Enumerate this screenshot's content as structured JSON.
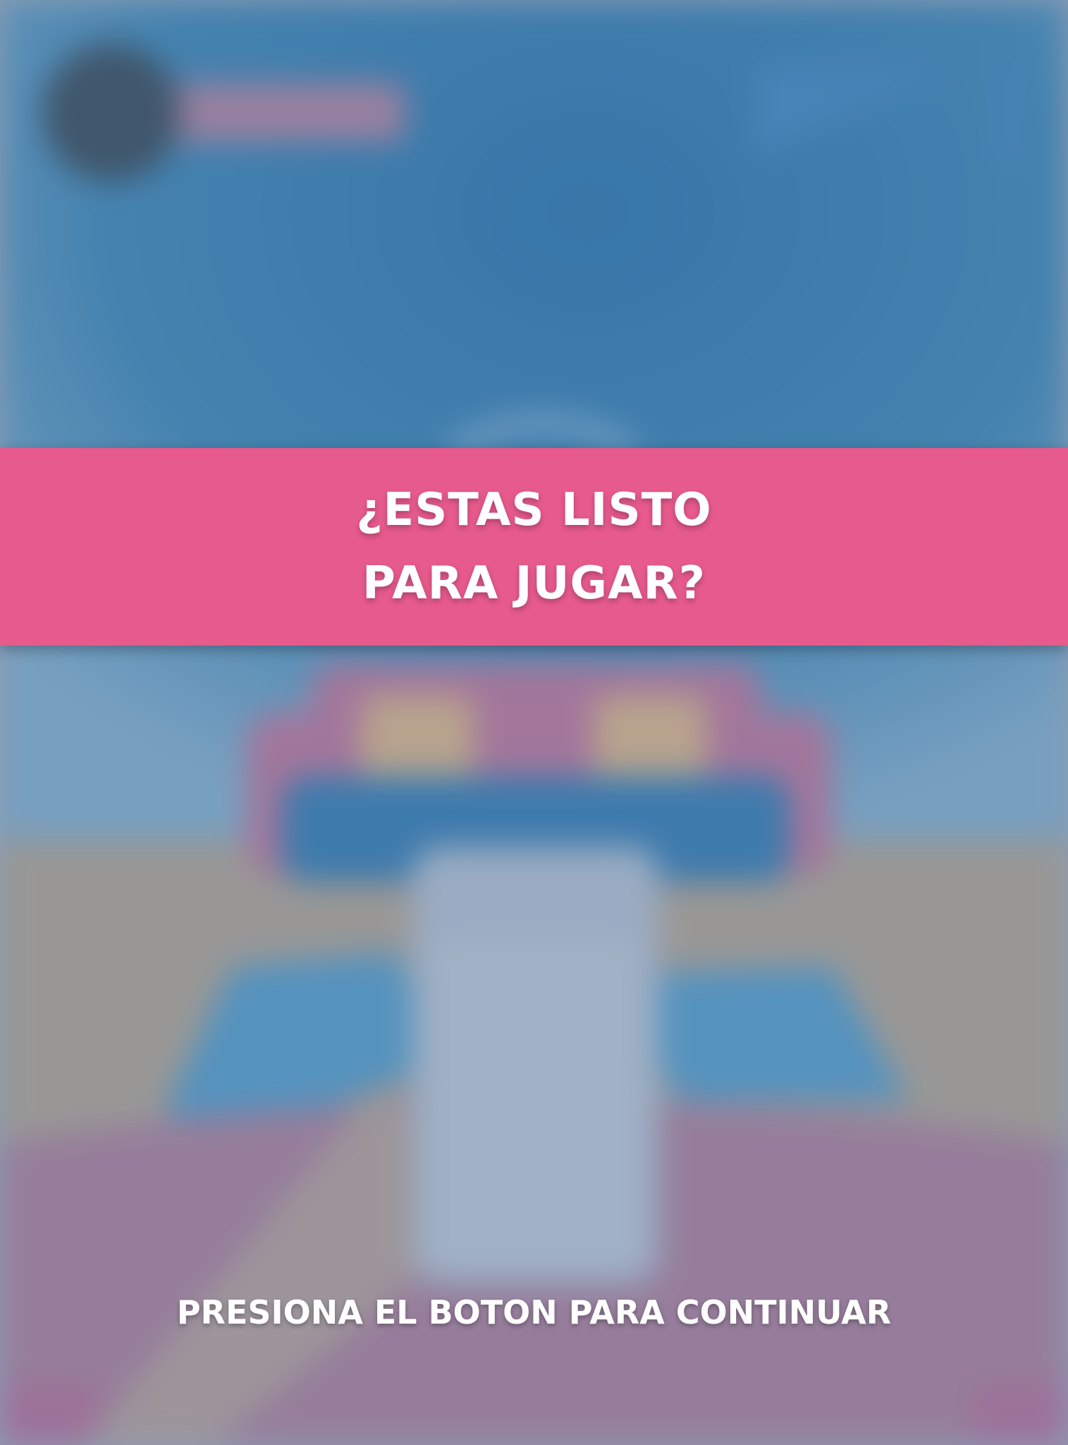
{
  "overlay": {
    "prompt_line_1": "¿ESTAS LISTO",
    "prompt_line_2": "PARA JUGAR?",
    "continue_hint": "PRESIONA EL BOTON PARA CONTINUAR"
  },
  "colors": {
    "banner": "#e75a8c",
    "sky": "#1e6ea6",
    "ground": "#9a9488",
    "table": "#96708f",
    "text": "#ffffff"
  },
  "icons": {
    "avatar": "avatar-icon",
    "flag": "flag-icon"
  }
}
